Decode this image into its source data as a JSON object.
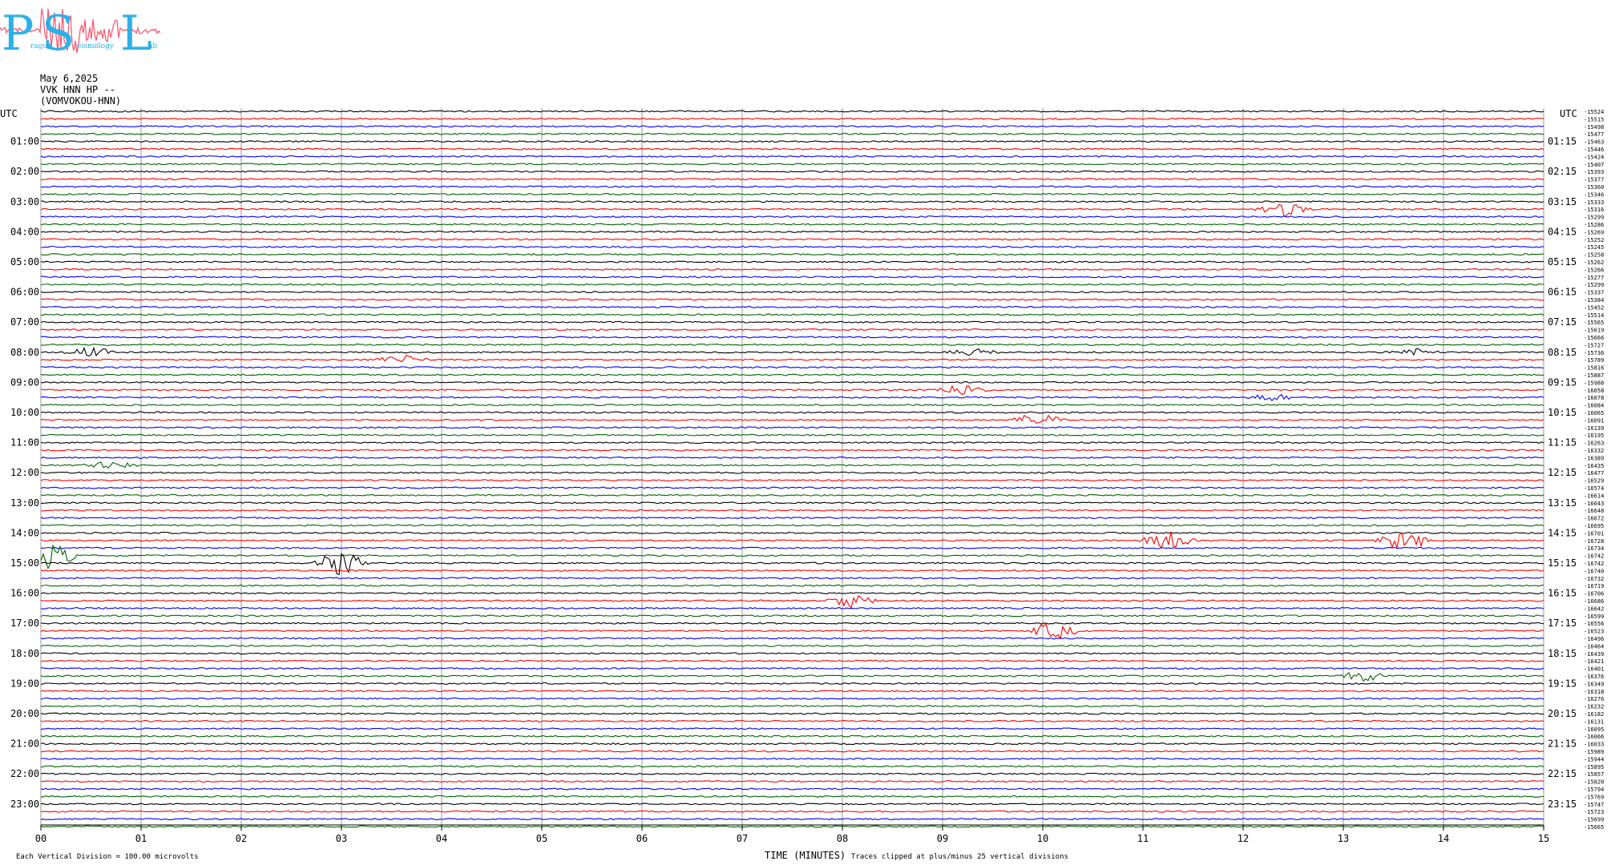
{
  "logo": {
    "letters": [
      "P",
      "S",
      "L"
    ],
    "subtitle_fragments": [
      "rague",
      "eismology",
      "ab"
    ],
    "colors": {
      "letters": "#2bb0e8",
      "trace": "#ff4f6a"
    }
  },
  "header": {
    "date": "May 6,2025",
    "channel": "VVK HNN HP --",
    "station": "(VOMVOKOU-HNN)"
  },
  "footer": {
    "vertical_division": "Each Vertical Division =  100.00 microvolts",
    "time_label": "TIME (MINUTES)",
    "clip_note": "Traces clipped at plus/minus 25 vertical divisions"
  },
  "chart_data": {
    "type": "line",
    "title": "",
    "xlabel": "TIME (MINUTES)",
    "xlim": [
      0,
      15
    ],
    "x_ticks": [
      "00",
      "01",
      "02",
      "03",
      "04",
      "05",
      "06",
      "07",
      "08",
      "09",
      "10",
      "11",
      "12",
      "13",
      "14",
      "15"
    ],
    "left_axis_title": "UTC",
    "right_axis_title": "UTC",
    "left_hour_labels": [
      "01:00",
      "02:00",
      "03:00",
      "04:00",
      "05:00",
      "06:00",
      "07:00",
      "08:00",
      "09:00",
      "10:00",
      "11:00",
      "12:00",
      "13:00",
      "14:00",
      "15:00",
      "16:00",
      "17:00",
      "18:00",
      "19:00",
      "20:00",
      "21:00",
      "22:00",
      "23:00"
    ],
    "right_hour_labels": [
      "01:15",
      "02:15",
      "03:15",
      "04:15",
      "05:15",
      "06:15",
      "07:15",
      "08:15",
      "09:15",
      "10:15",
      "11:15",
      "12:15",
      "13:15",
      "14:15",
      "15:15",
      "16:15",
      "17:15",
      "18:15",
      "19:15",
      "20:15",
      "21:15",
      "22:15",
      "23:15"
    ],
    "trace_colors": [
      "#000000",
      "#ff0000",
      "#0000ff",
      "#006400"
    ],
    "trace_offsets": [
      "-15524",
      "-15515",
      "-15498",
      "-15477",
      "-15463",
      "-15446",
      "-15424",
      "-15407",
      "-15393",
      "-15377",
      "-15360",
      "-15346",
      "-15333",
      "-15316",
      "-15299",
      "-15286",
      "-15269",
      "-15252",
      "-15245",
      "-15258",
      "-15262",
      "-15266",
      "-15277",
      "-15299",
      "-15337",
      "-15384",
      "-15452",
      "-15514",
      "-15565",
      "-15619",
      "-15666",
      "-15727",
      "-15736",
      "-15789",
      "-15816",
      "-15887",
      "-15988",
      "-16058",
      "-16078",
      "-16084",
      "-16065",
      "-16091",
      "-16139",
      "-16195",
      "-16263",
      "-16332",
      "-16389",
      "-16435",
      "-16477",
      "-16529",
      "-16574",
      "-16614",
      "-16643",
      "-16648",
      "-16672",
      "-16695",
      "-16701",
      "-16728",
      "-16734",
      "-16742",
      "-16742",
      "-16740",
      "-16732",
      "-16719",
      "-16706",
      "-16686",
      "-16642",
      "-16599",
      "-16556",
      "-16523",
      "-16496",
      "-16464",
      "-16439",
      "-16421",
      "-16401",
      "-16376",
      "-16349",
      "-16318",
      "-16276",
      "-16232",
      "-16182",
      "-16131",
      "-16095",
      "-16066",
      "-16033",
      "-15989",
      "-15944",
      "-15895",
      "-15857",
      "-15820",
      "-15794",
      "-15769",
      "-15747",
      "-15723",
      "-15699",
      "-15665"
    ],
    "events": [
      {
        "trace": 13,
        "minute": 12.4,
        "amplitude": 3
      },
      {
        "trace": 32,
        "minute": 0.5,
        "amplitude": 2
      },
      {
        "trace": 32,
        "minute": 9.3,
        "amplitude": 1.5
      },
      {
        "trace": 32,
        "minute": 13.7,
        "amplitude": 1.5
      },
      {
        "trace": 33,
        "minute": 3.6,
        "amplitude": 2
      },
      {
        "trace": 37,
        "minute": 9.2,
        "amplitude": 2
      },
      {
        "trace": 38,
        "minute": 12.3,
        "amplitude": 1.5
      },
      {
        "trace": 41,
        "minute": 9.95,
        "amplitude": 3
      },
      {
        "trace": 47,
        "minute": 0.7,
        "amplitude": 1.5
      },
      {
        "trace": 57,
        "minute": 11.25,
        "amplitude": 4
      },
      {
        "trace": 57,
        "minute": 13.6,
        "amplitude": 5
      },
      {
        "trace": 59,
        "minute": 0.1,
        "amplitude": 6
      },
      {
        "trace": 60,
        "minute": 3.0,
        "amplitude": 6
      },
      {
        "trace": 65,
        "minute": 8.1,
        "amplitude": 3
      },
      {
        "trace": 69,
        "minute": 10.1,
        "amplitude": 4
      },
      {
        "trace": 75,
        "minute": 13.2,
        "amplitude": 2
      }
    ]
  }
}
